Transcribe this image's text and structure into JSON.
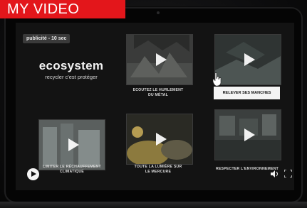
{
  "badge": {
    "label": "MY VIDEO"
  },
  "ad": {
    "label": "publicité - 10 sec"
  },
  "brand": {
    "name": "ecosystem",
    "tagline": "recycler c'est protéger"
  },
  "tiles": [
    {
      "caption": "ECOUTEZ LE HURLEMENT\nDU MÉTAL"
    },
    {
      "caption": "RELEVER SES MANCHES"
    },
    {
      "caption": "LIMITER LE RÉCHAUFFEMENT\nCLIMATIQUE"
    },
    {
      "caption": "TOUTE LA LUMIÈRE SUR\nLE MERCURE"
    },
    {
      "caption": "RESPECTER L'ENVIRONNEMENT"
    }
  ],
  "colors": {
    "badge": "#e3161b",
    "screen": "#131313"
  },
  "icons": [
    "play-icon",
    "volume-icon",
    "fullscreen-icon",
    "hand-cursor-icon"
  ]
}
